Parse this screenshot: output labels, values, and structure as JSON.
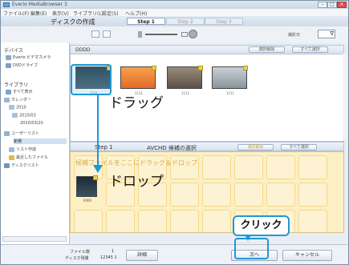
{
  "window": {
    "title": "Everio MediaBrowser 3"
  },
  "menubar": [
    "ファイル(F)",
    "編集(E)",
    "表示(V)",
    "ライブラリ(L)",
    "設定(S)",
    "ヘルプ(H)"
  ],
  "header": {
    "section_title": "ディスクの作成",
    "steps": [
      "Step 1",
      "Step 2",
      "Step 3"
    ],
    "active_step": 1
  },
  "toolbar": {
    "sort_label": "撮影日",
    "sort_value": "∇"
  },
  "sidebar": {
    "device_heading": "デバイス",
    "device_items": [
      "Everio ビデオカメラ",
      "DVDドライブ"
    ],
    "library_heading": "ライブラリ",
    "library_items": [
      "すべて表示",
      "カレンダー",
      "2010",
      "2010/03",
      "2010/03/20",
      "ユーザーリスト",
      "新規",
      "リスト作成",
      "最近したファイル",
      "ディスクリスト"
    ]
  },
  "upper_pane": {
    "label": "DDDD",
    "buttons": [
      "選択解除",
      "すべて選択"
    ],
    "thumb_captions": [
      "1111",
      "1111",
      "1111",
      "1111"
    ]
  },
  "annotations": {
    "drag": "ドラッグ",
    "drop": "ドロップ",
    "click": "クリック"
  },
  "lower_pane": {
    "step_label": "Step 1",
    "disc_label": "AVCHD 候補の選択",
    "buttons": [
      "選択解除",
      "すべて選択"
    ],
    "hint": "候補ファイルをここにドラッグ＆ドロップ",
    "dropped_caption": "0000"
  },
  "bottom": {
    "info_label_1": "ファイル数",
    "info_value_1": "1",
    "info_label_2": "ディスク残量",
    "info_value_2": "12345 1",
    "apply": "詳細",
    "next": "次へ",
    "cancel": "キャンセル"
  },
  "colors": {
    "accent": "#1f98d8",
    "drop_zone": "#fcefc4"
  }
}
